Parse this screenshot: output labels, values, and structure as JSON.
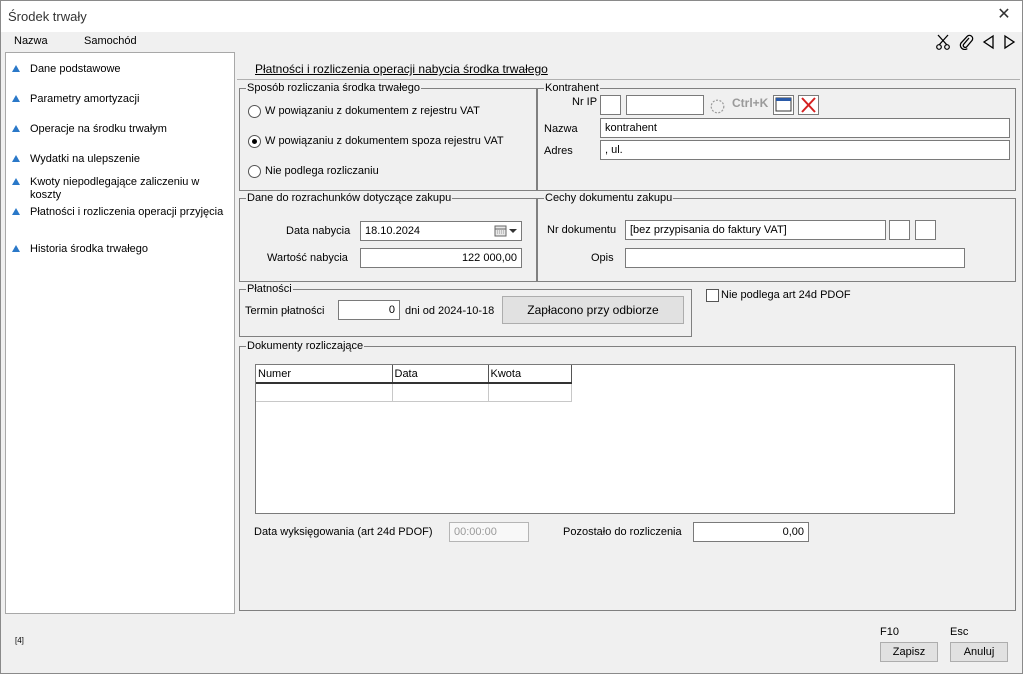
{
  "window": {
    "title": "Środek trwały",
    "close_icon": "close-icon"
  },
  "header": {
    "left_labels": [
      "Nazwa",
      "Samochód"
    ],
    "tools": [
      "scissors-icon",
      "paperclip-icon",
      "arrow-left-icon",
      "arrow-right-icon"
    ]
  },
  "sidebar": {
    "items": [
      {
        "label": "Dane podstawowe"
      },
      {
        "label": "Parametry amortyzacji"
      },
      {
        "label": "Operacje na środku trwałym"
      },
      {
        "label": "Wydatki na ulepszenie"
      },
      {
        "label": "Kwoty niepodlegające zaliczeniu w koszty"
      },
      {
        "label": "Płatności i rozliczenia operacji przyjęcia"
      },
      {
        "label": "Historia środka trwałego"
      }
    ],
    "arrow_color": "#2a78c8"
  },
  "main": {
    "section_title": "Płatności i rozliczenia operacji nabycia środka trwałego",
    "settlement_method": {
      "legend": "Sposób rozliczania środka trwałego",
      "options": [
        {
          "label": "W powiązaniu z dokumentem z rejestru VAT",
          "selected": false
        },
        {
          "label": "W powiązaniu z dokumentem spoza rejestru VAT",
          "selected": true
        },
        {
          "label": "Nie podlega rozliczaniu",
          "selected": false
        }
      ]
    },
    "contractor": {
      "legend": "Kontrahent",
      "nr_ip_label": "Nr IP",
      "nr_ip_prefix": "",
      "nr_ip_value": "",
      "shortcut": "Ctrl+K",
      "name_label": "Nazwa",
      "name_value": "kontrahent",
      "address_label": "Adres",
      "address_value": ", ul."
    },
    "purchase_data": {
      "legend": "Dane do rozrachunków dotyczące zakupu",
      "date_label": "Data nabycia",
      "date_value": "18.10.2024",
      "value_label": "Wartość nabycia",
      "value_value": "122 000,00"
    },
    "purchase_doc": {
      "legend": "Cechy dokumentu zakupu",
      "doc_number_label": "Nr dokumentu",
      "doc_number_value": "[bez przypisania do faktury VAT]",
      "description_label": "Opis",
      "description_value": ""
    },
    "payments": {
      "legend": "Płatności",
      "term_label": "Termin płatności",
      "term_value": "0",
      "days_from_label": "dni od 2024-10-18",
      "paid_button": "Zapłacono przy odbiorze"
    },
    "art24d": {
      "label": "Nie podlega art 24d PDOF",
      "checked": false
    },
    "settling_docs": {
      "legend": "Dokumenty rozliczające",
      "columns": [
        "Numer",
        "Data",
        "Kwota"
      ],
      "rows": [],
      "removal_date_label": "Data wyksięgowania (art 24d PDOF)",
      "removal_date_value": "00:00:00",
      "remaining_label": "Pozostało do rozliczenia",
      "remaining_value": "0,00"
    }
  },
  "footer": {
    "save_shortcut": "F10",
    "save_label": "Zapisz",
    "cancel_shortcut": "Esc",
    "cancel_label": "Anuluj",
    "status_number": "[4]"
  }
}
